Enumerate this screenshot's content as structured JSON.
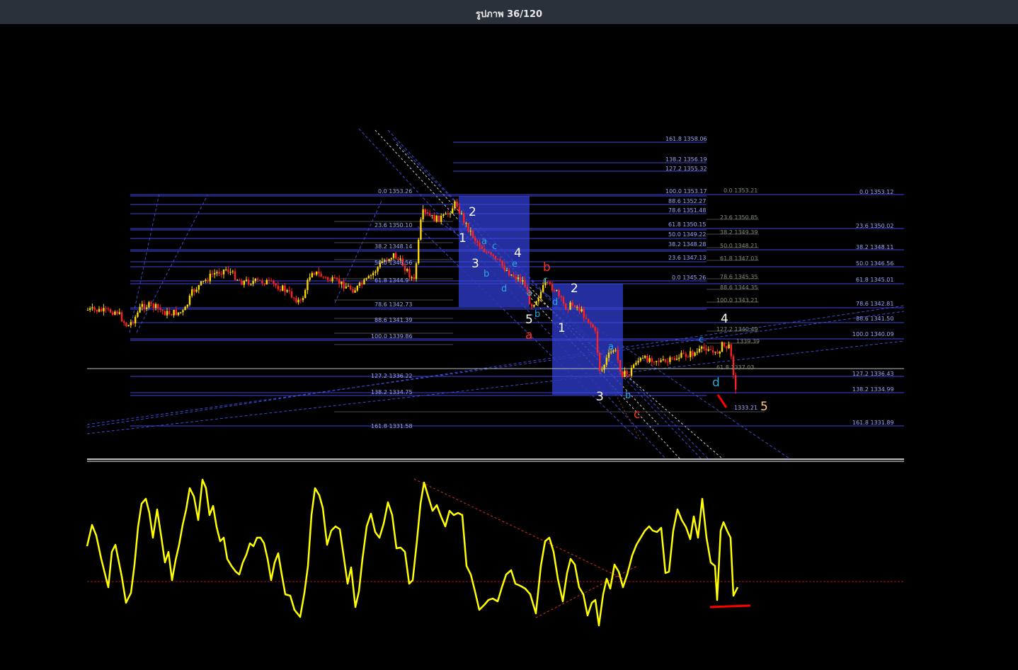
{
  "header": {
    "title": "รูปภาพ 36/120"
  },
  "colors": {
    "background": "#000000",
    "bull_candle": "#ffd700",
    "bear_candle": "#ff2020",
    "fib_line": "#3c46d9",
    "box_fill": "#2a36b8",
    "oscillator": "#ffff00",
    "marker_red": "#ff0000"
  },
  "chart_data": {
    "type": "candlestick",
    "indicator": "oscillator",
    "fib_labels": [
      "161.8 1358.06",
      "138.2 1356.19",
      "127.2 1355.32",
      "0.0 1353.26",
      "100.0 1353.17",
      "0.0 1353.21",
      "0.0 1353.12",
      "88.6 1352.27",
      "78.6 1351.48",
      "23.6 1350.85",
      "23.6 1350.10",
      "61.8 1350.15",
      "23.6 1350.02",
      "50.0 1349.22",
      "38.2 1349.39",
      "38.2 1348.14",
      "38.2 1348.28",
      "50.0 1348.21",
      "38.2 1348.11",
      "23.6 1347.13",
      "61.8 1347.03",
      "50.0 1346.56",
      "50.0 1346.56",
      "0.0 1345.26",
      "78.6 1345.35",
      "61.8 1345.01",
      "61.8 1344.9",
      "88.6 1344.35",
      "100.0 1343.21",
      "78.6 1342.73",
      "78.6 1342.81",
      "88.6 1341.39",
      "88.6 1341.50",
      "127.2 1340.49",
      "100.0 1339.86",
      "100.0 1340.09",
      "1339.39",
      "61.8 1337.03",
      "127.2 1336.22",
      "127.2 1336.43",
      "138.2 1334.75",
      "138.2 1334.99",
      "1333.21",
      "161.8 1331.58",
      "161.8 1331.89"
    ],
    "wave_labels": [
      "2",
      "1",
      "3",
      "4",
      "5",
      "a",
      "b",
      "1",
      "2",
      "3",
      "b",
      "c",
      "4",
      "5",
      "a",
      "b",
      "c",
      "d",
      "e",
      "a",
      "b",
      "c",
      "d",
      "c",
      "a",
      "d"
    ]
  }
}
